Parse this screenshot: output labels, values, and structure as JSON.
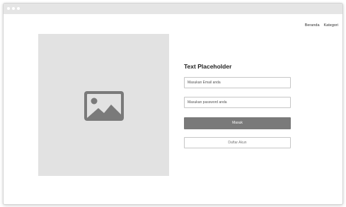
{
  "nav": {
    "items": [
      "Beranda",
      "Kategori"
    ]
  },
  "hero": {
    "icon": "image-icon"
  },
  "login": {
    "title": "Text Placeholder",
    "email_placeholder": "Masukan Email anda",
    "password_placeholder": "Masukan password anda",
    "submit_label": "Masuk",
    "register_label": "Daftar Akun"
  },
  "colors": {
    "titlebar": "#e5e5e5",
    "image_placeholder": "#e2e2e2",
    "icon": "#7a7a7a",
    "primary_button": "#7a7a7a",
    "field_border": "#c6c6c6"
  }
}
